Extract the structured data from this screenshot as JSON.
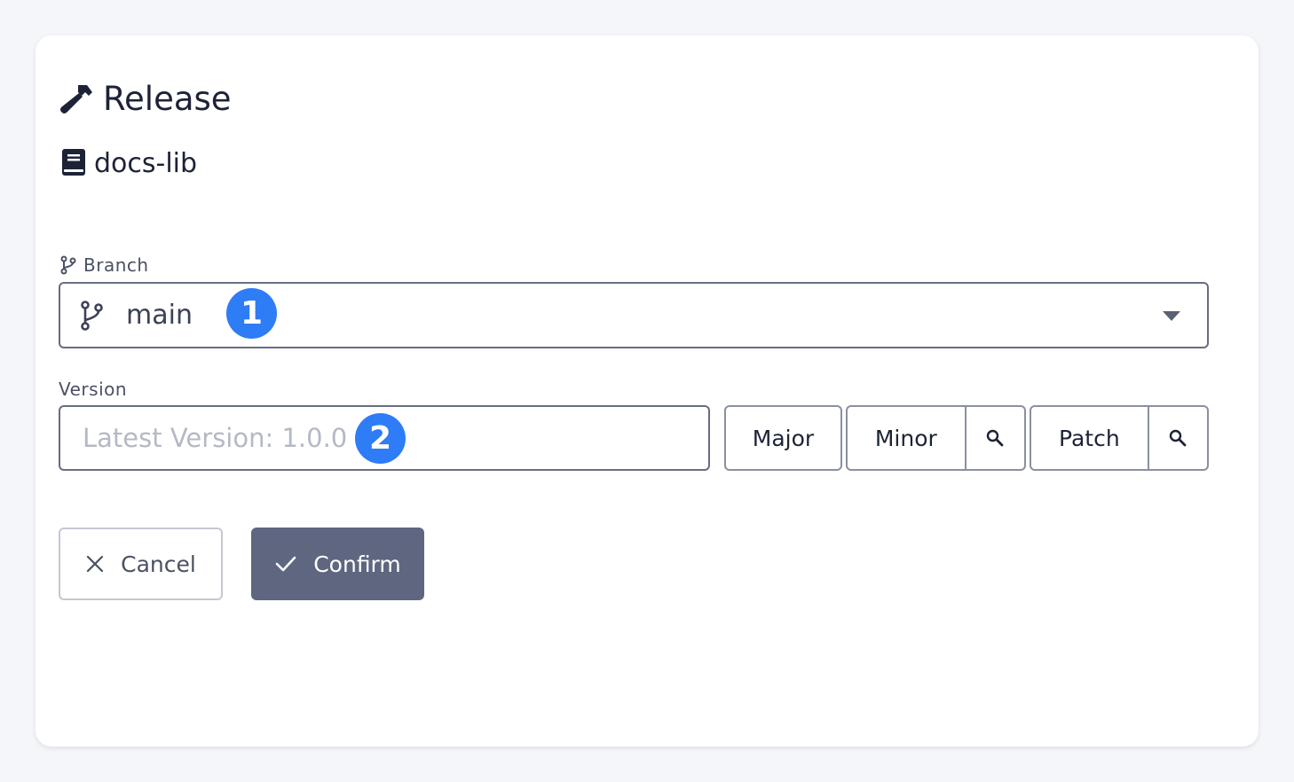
{
  "dialog": {
    "title": "Release",
    "title_icon": "hammer-icon",
    "repo_icon": "book-icon",
    "repo_name": "docs-lib"
  },
  "branch": {
    "label": "Branch",
    "label_icon": "git-branch-icon",
    "selected_value": "main",
    "badge": "1"
  },
  "version": {
    "label": "Version",
    "placeholder": "Latest Version: 1.0.0",
    "value": "",
    "badge": "2",
    "buttons": {
      "major": "Major",
      "minor": "Minor",
      "patch": "Patch"
    },
    "search_icon": "search-icon"
  },
  "actions": {
    "cancel_label": "Cancel",
    "cancel_icon": "close-icon",
    "confirm_label": "Confirm",
    "confirm_icon": "check-icon"
  },
  "colors": {
    "badge": "#2e7cf6",
    "confirm_background": "#5f6680",
    "page_background": "#f5f6fa"
  }
}
